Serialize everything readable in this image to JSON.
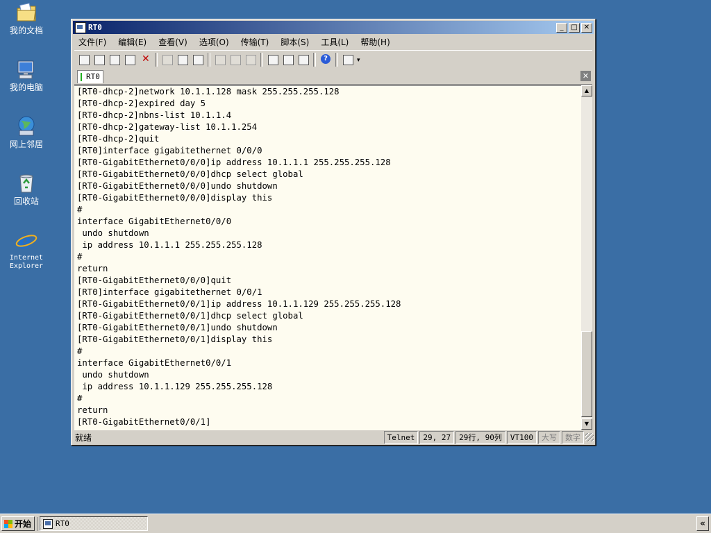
{
  "desktop": {
    "icons": [
      {
        "label": "我的文档",
        "icon": "folder-documents-icon"
      },
      {
        "label": "我的电脑",
        "icon": "computer-icon"
      },
      {
        "label": "网上邻居",
        "icon": "network-icon"
      },
      {
        "label": "回收站",
        "icon": "recycle-bin-icon"
      },
      {
        "label": "Internet Explorer",
        "icon": "ie-icon"
      }
    ],
    "background_color": "#3a6ea5"
  },
  "window": {
    "title": "RT0",
    "menu": [
      "文件(F)",
      "编辑(E)",
      "查看(V)",
      "选项(O)",
      "传输(T)",
      "脚本(S)",
      "工具(L)",
      "帮助(H)"
    ],
    "tab_label": "RT0",
    "terminal_lines": [
      "[RT0-dhcp-2]network 10.1.1.128 mask 255.255.255.128",
      "[RT0-dhcp-2]expired day 5",
      "[RT0-dhcp-2]nbns-list 10.1.1.4",
      "[RT0-dhcp-2]gateway-list 10.1.1.254",
      "[RT0-dhcp-2]quit",
      "[RT0]interface gigabitethernet 0/0/0",
      "[RT0-GigabitEthernet0/0/0]ip address 10.1.1.1 255.255.255.128",
      "[RT0-GigabitEthernet0/0/0]dhcp select global",
      "[RT0-GigabitEthernet0/0/0]undo shutdown",
      "[RT0-GigabitEthernet0/0/0]display this",
      "#",
      "interface GigabitEthernet0/0/0",
      " undo shutdown",
      " ip address 10.1.1.1 255.255.255.128",
      "#",
      "return",
      "[RT0-GigabitEthernet0/0/0]quit",
      "[RT0]interface gigabitethernet 0/0/1",
      "[RT0-GigabitEthernet0/0/1]ip address 10.1.1.129 255.255.255.128",
      "[RT0-GigabitEthernet0/0/1]dhcp select global",
      "[RT0-GigabitEthernet0/0/1]undo shutdown",
      "[RT0-GigabitEthernet0/0/1]display this",
      "#",
      "interface GigabitEthernet0/0/1",
      " undo shutdown",
      " ip address 10.1.1.129 255.255.255.128",
      "#",
      "return",
      "[RT0-GigabitEthernet0/0/1]"
    ],
    "status": {
      "text": "就绪",
      "protocol": "Telnet",
      "cursor": "29,  27",
      "rows_cols": "29行, 90列",
      "emulation": "VT100",
      "caps": "大写",
      "num": "数字"
    }
  },
  "taskbar": {
    "start_label": "开始",
    "task_label": "RT0",
    "tray_chevron": "«"
  }
}
